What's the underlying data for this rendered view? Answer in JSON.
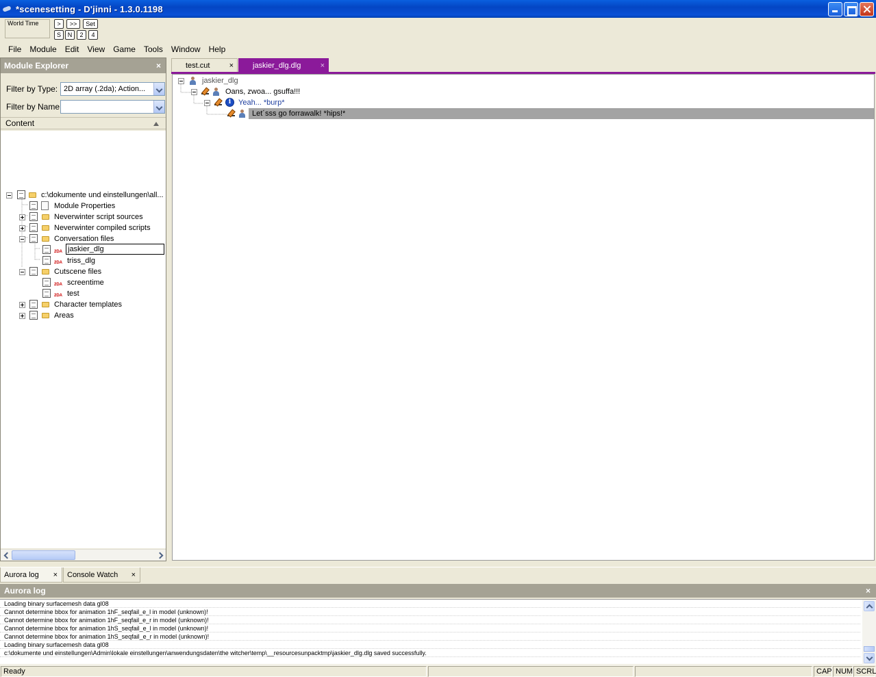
{
  "window": {
    "title": "*scenesetting - D'jinni - 1.3.0.1198"
  },
  "worldtime": {
    "label": "World Time",
    "buttons": [
      ">",
      ">>",
      "Set",
      "S",
      "N",
      "2",
      "4"
    ]
  },
  "menu": [
    "File",
    "Module",
    "Edit",
    "View",
    "Game",
    "Tools",
    "Window",
    "Help"
  ],
  "explorer": {
    "title": "Module Explorer",
    "close": "×",
    "filter_type_label": "Filter by Type:",
    "filter_type_value": "2D array (.2da); Action...",
    "filter_name_label": "Filter by Name:",
    "filter_name_value": "",
    "content_label": "Content",
    "tree": [
      "c:\\dokumente und einstellungen\\all...",
      "Module Properties",
      "Neverwinter script sources",
      "Neverwinter compiled scripts",
      "Conversation files",
      "jaskier_dlg",
      "triss_dlg",
      "Cutscene files",
      "screentime",
      "test",
      "Character templates",
      "Areas"
    ],
    "badge_2da": "2DA"
  },
  "tabs": [
    {
      "label": "test.cut",
      "close": "×"
    },
    {
      "label": "jaskier_dlg.dlg",
      "close": "×"
    }
  ],
  "conversation": [
    "jaskier_dlg",
    "Oans, zwoa... gsuffa!!!",
    "Yeah... *burp*",
    "Let´sss go forrawalk! *hips!*"
  ],
  "info_glyph": "i",
  "bottom": {
    "tabs": [
      {
        "label": "Aurora log",
        "close": "×"
      },
      {
        "label": "Console Watch",
        "close": "×"
      }
    ],
    "log_title": "Aurora log",
    "log_close": "×",
    "log_lines": [
      "Loading binary surfacemesh data gl08",
      "Cannot determine bbox for animation 1hF_seqfail_e_l in model (unknown)!",
      "Cannot determine bbox for animation 1hF_seqfail_e_r in model (unknown)!",
      "Cannot determine bbox for animation 1hS_seqfail_e_l in model (unknown)!",
      "Cannot determine bbox for animation 1hS_seqfail_e_r in model (unknown)!",
      "Loading binary surfacemesh data gl08",
      "c:\\dokumente und einstellungen\\Admin\\lokale einstellungen\\anwendungsdaten\\the witcher\\temp\\__resourcesunpacktmp\\jaskier_dlg.dlg saved successfully."
    ]
  },
  "status": {
    "text": "Ready",
    "cap": "CAP",
    "num": "NUM",
    "scrl": "SCRL"
  }
}
